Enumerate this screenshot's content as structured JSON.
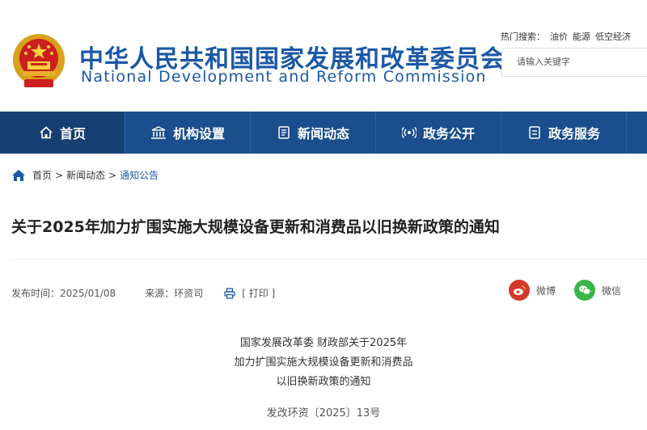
{
  "header": {
    "title_cn": "中华人民共和国国家发展和改革委员会",
    "title_en": "National Development and Reform Commission",
    "hot_search_label": "热门搜索：",
    "hot_keywords": [
      "油价",
      "能源",
      "低空经济"
    ],
    "search_placeholder": "请输入关键字"
  },
  "nav": {
    "items": [
      {
        "label": "首页",
        "icon": "home-icon"
      },
      {
        "label": "机构设置",
        "icon": "building-icon"
      },
      {
        "label": "新闻动态",
        "icon": "news-icon"
      },
      {
        "label": "政务公开",
        "icon": "broadcast-icon"
      },
      {
        "label": "政务服务",
        "icon": "service-icon"
      }
    ],
    "active_color": "#163f72",
    "bar_color": "#1a4e8c"
  },
  "breadcrumb": {
    "items": [
      "首页",
      "新闻动态",
      "通知公告"
    ],
    "separator": ">"
  },
  "article": {
    "title": "关于2025年加力扩围实施大规模设备更新和消费品以旧换新政策的通知",
    "publish_label": "发布时间：",
    "publish_date": "2025/01/08",
    "source_label": "来源：",
    "source": "环资司",
    "print_label": "[ 打印 ]",
    "share_weibo": "微博",
    "share_wechat": "微信",
    "doc_head_lines": [
      "国家发展改革委 财政部关于2025年",
      "加力扩围实施大规模设备更新和消费品",
      "以旧换新政策的通知"
    ],
    "doc_number": "发改环资〔2025〕13号"
  }
}
